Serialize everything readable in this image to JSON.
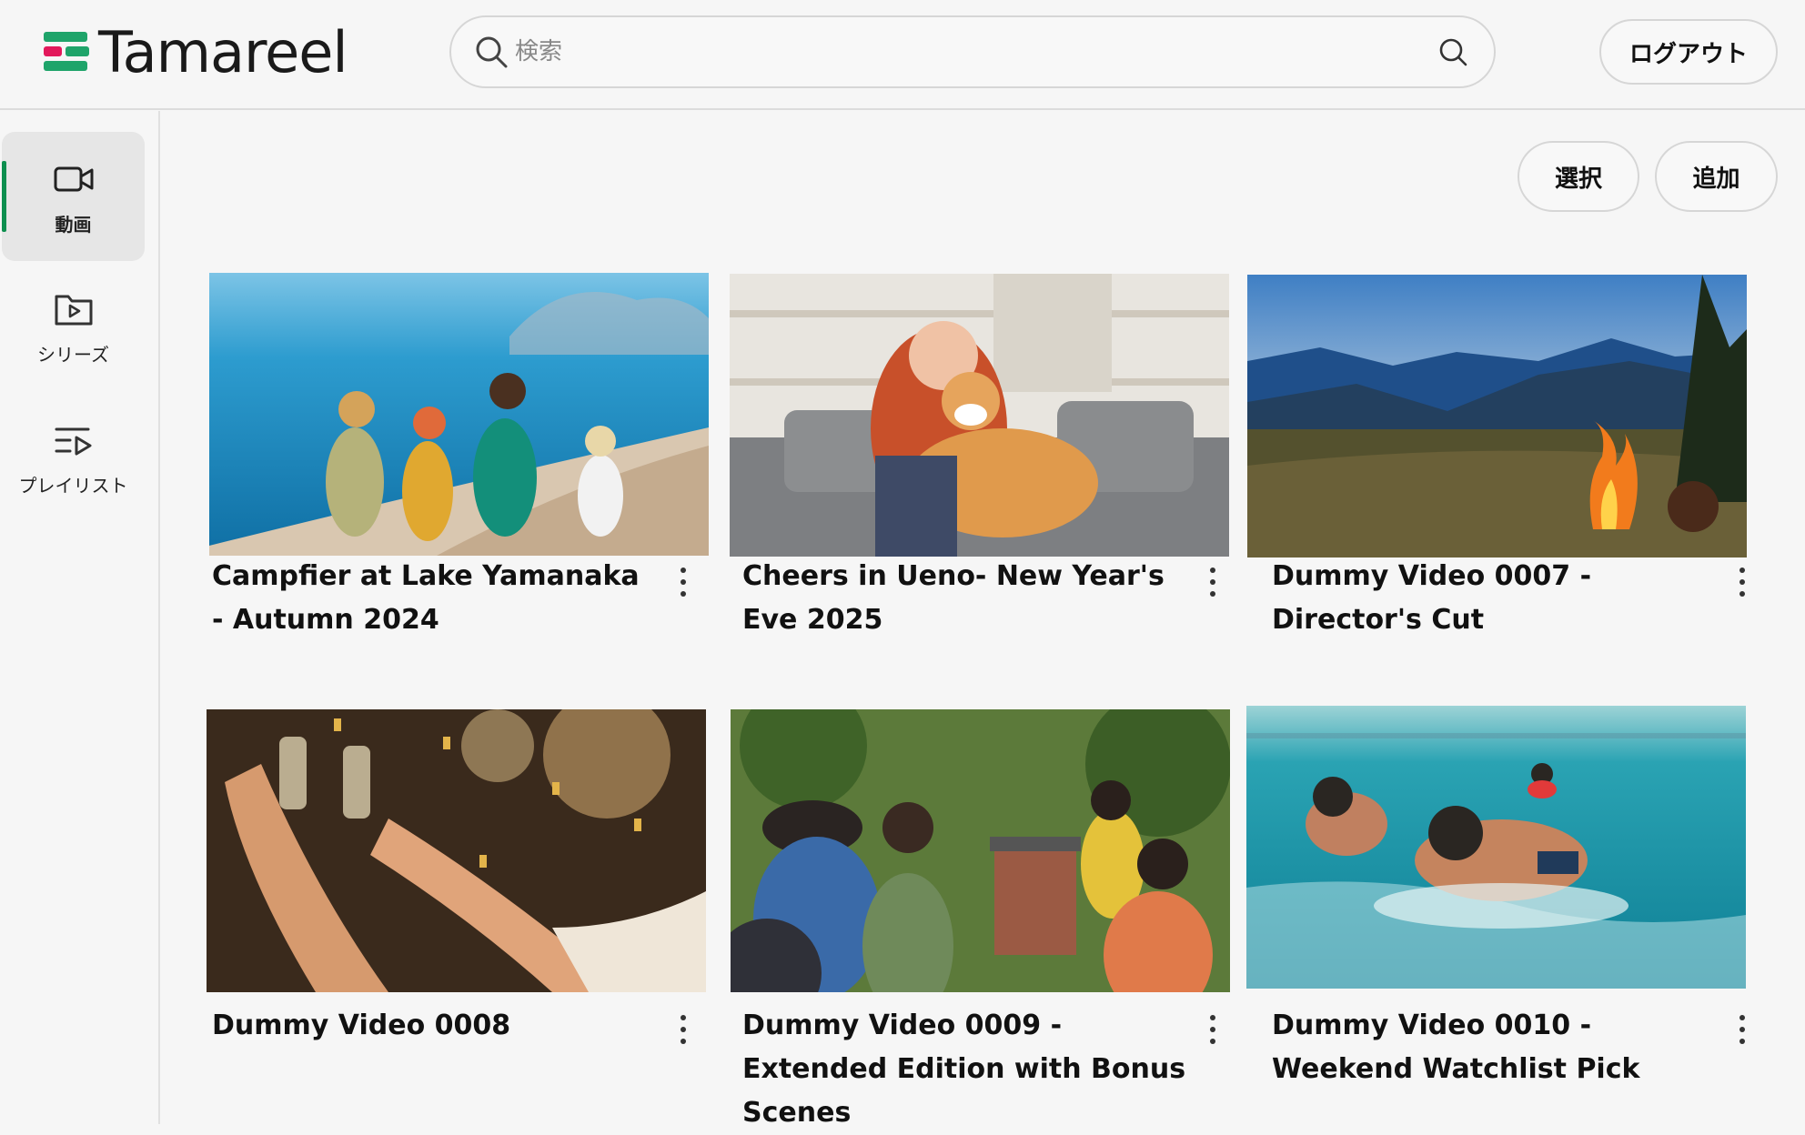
{
  "app": {
    "name": "Tamareel"
  },
  "header": {
    "search_placeholder": "検索",
    "logout_label": "ログアウト"
  },
  "sidebar": {
    "items": [
      {
        "label": "動画",
        "icon": "video-camera-icon",
        "active": true
      },
      {
        "label": "シリーズ",
        "icon": "folder-play-icon",
        "active": false
      },
      {
        "label": "プレイリスト",
        "icon": "playlist-icon",
        "active": false
      }
    ]
  },
  "toolbar": {
    "select_label": "選択",
    "add_label": "追加"
  },
  "videos": [
    {
      "title": "Campfier at Lake Yamanaka - Autumn 2024",
      "thumbnail": "family-on-beach"
    },
    {
      "title": "Cheers in Ueno- New Year's Eve 2025",
      "thumbnail": "woman-with-shiba-dog"
    },
    {
      "title": "Dummy Video 0007 - Director's Cut",
      "thumbnail": "campfire-mountains"
    },
    {
      "title": "Dummy Video 0008",
      "thumbnail": "champagne-toast"
    },
    {
      "title": "Dummy Video 0009 - Extended Edition with Bonus Scenes",
      "thumbnail": "garden-barbecue"
    },
    {
      "title": "Dummy Video 0010 - Weekend Watchlist Pick",
      "thumbnail": "kids-swimming-sea"
    }
  ],
  "colors": {
    "accent": "#0d8f4f",
    "logo_green": "#1fa46a",
    "logo_pink": "#e2195b",
    "background": "#f6f6f6"
  }
}
